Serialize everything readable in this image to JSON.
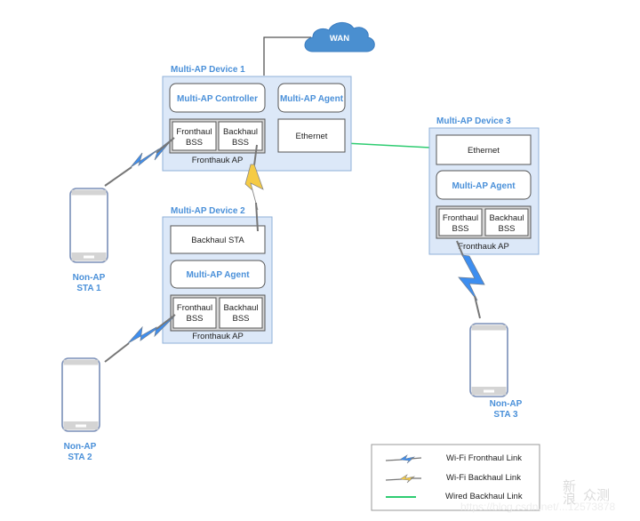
{
  "wan": {
    "label": "WAN"
  },
  "devices": [
    {
      "title": "Multi-AP Device 1",
      "controller": "Multi-AP Controller",
      "agent": "Multi-AP Agent",
      "ethernet": "Ethernet",
      "fronthaul_bss": [
        "Fronthaul",
        "BSS"
      ],
      "backhaul_bss": [
        "Backhaul",
        "BSS"
      ],
      "ap_label": "Fronthauk AP"
    },
    {
      "title": "Multi-AP Device 2",
      "backhaul_sta": "Backhaul STA",
      "agent": "Multi-AP Agent",
      "fronthaul_bss": [
        "Fronthaul",
        "BSS"
      ],
      "backhaul_bss": [
        "Backhaul",
        "BSS"
      ],
      "ap_label": "Fronthauk AP"
    },
    {
      "title": "Multi-AP Device 3",
      "ethernet": "Ethernet",
      "agent": "Multi-AP Agent",
      "fronthaul_bss": [
        "Fronthaul",
        "BSS"
      ],
      "backhaul_bss": [
        "Backhaul",
        "BSS"
      ],
      "ap_label": "Fronthauk AP"
    }
  ],
  "stations": [
    {
      "line1": "Non-AP",
      "line2": "STA 1"
    },
    {
      "line1": "Non-AP",
      "line2": "STA 2"
    },
    {
      "line1": "Non-AP",
      "line2": "STA 3"
    }
  ],
  "legend": [
    {
      "label": "Wi-Fi Fronthaul Link",
      "icon": "lightning-blue-icon"
    },
    {
      "label": "Wi-Fi Backhaul Link",
      "icon": "lightning-yellow-icon"
    },
    {
      "label": "Wired Backhaul Link",
      "icon": "green-line-icon"
    }
  ],
  "watermark": {
    "brand_top": "新",
    "brand_bottom": "浪",
    "brand_main": "众测",
    "url": "https://blog.csdn.net/...12573878"
  },
  "colors": {
    "device_fill": "#dce8f8",
    "device_stroke": "#8fb0d8",
    "accent_text": "#4a90d9",
    "cloud": "#4a8fd0",
    "fronthaul_link": "#3d8ef0",
    "backhaul_link": "#f5cb45",
    "wired_link": "#2ecc71"
  }
}
